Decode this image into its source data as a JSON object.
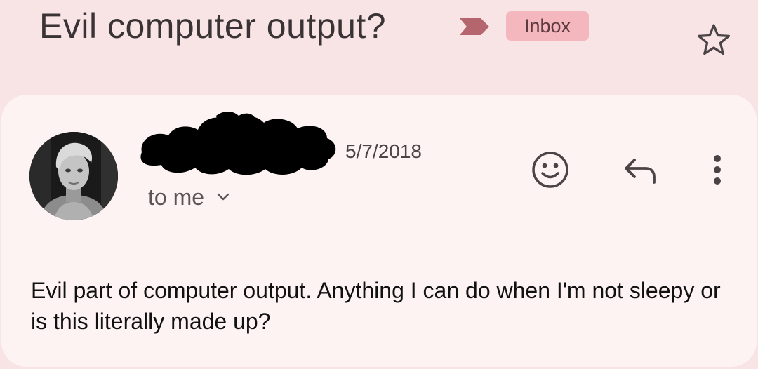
{
  "message": {
    "subject": "Evil computer output?",
    "label": "Inbox",
    "date": "5/7/2018",
    "recipients_label": "to me",
    "body": "Evil part of computer output. Anything I can do when I'm not sleepy or is this literally made up?",
    "sender_redacted": true
  },
  "icons": {
    "importance": "importance-marker-icon",
    "star": "star-icon",
    "emoji": "emoji-reaction-icon",
    "reply": "reply-icon",
    "more": "more-vert-icon",
    "expand": "chevron-down-icon"
  },
  "colors": {
    "background": "#f8e4e5",
    "card": "#fdf3f3",
    "label_chip": "#f4b7bd",
    "importance_marker": "#b5656d"
  }
}
